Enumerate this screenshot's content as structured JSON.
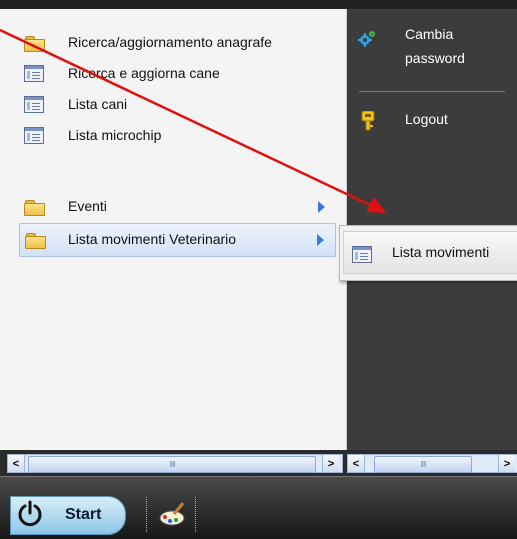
{
  "menu": {
    "items": [
      {
        "label": "Ricerca/aggiornamento anagrafe",
        "icon": "folder-icon",
        "has_submenu": false
      },
      {
        "label": "Ricerca e aggiorna cane",
        "icon": "list-icon",
        "has_submenu": false
      },
      {
        "label": "Lista cani",
        "icon": "list-icon",
        "has_submenu": false
      },
      {
        "label": "Lista microchip",
        "icon": "list-icon",
        "has_submenu": false
      },
      {
        "label": "Eventi",
        "icon": "folder-icon",
        "has_submenu": true
      },
      {
        "label": "Lista movimenti Veterinario",
        "icon": "folder-icon",
        "has_submenu": true,
        "active": true
      }
    ]
  },
  "right_panel": {
    "change_password_line1": "Cambia",
    "change_password_line2": "password",
    "logout": "Logout",
    "icons": [
      "gear-icon",
      "key-icon"
    ],
    "background": "#3c3c3c"
  },
  "submenu": {
    "item_label": "Lista movimenti",
    "icon": "list-icon"
  },
  "scrollbar": {
    "left_arrow": "<",
    "right_arrow": ">",
    "thumb_grip": "IIII"
  },
  "taskbar": {
    "start_label": "Start",
    "quicklaunch_icon": "paint-icon"
  },
  "colors": {
    "accent_arrow": "#3c78d8",
    "annotation_arrow": "#e01010",
    "selection": "#d3e1f5"
  }
}
